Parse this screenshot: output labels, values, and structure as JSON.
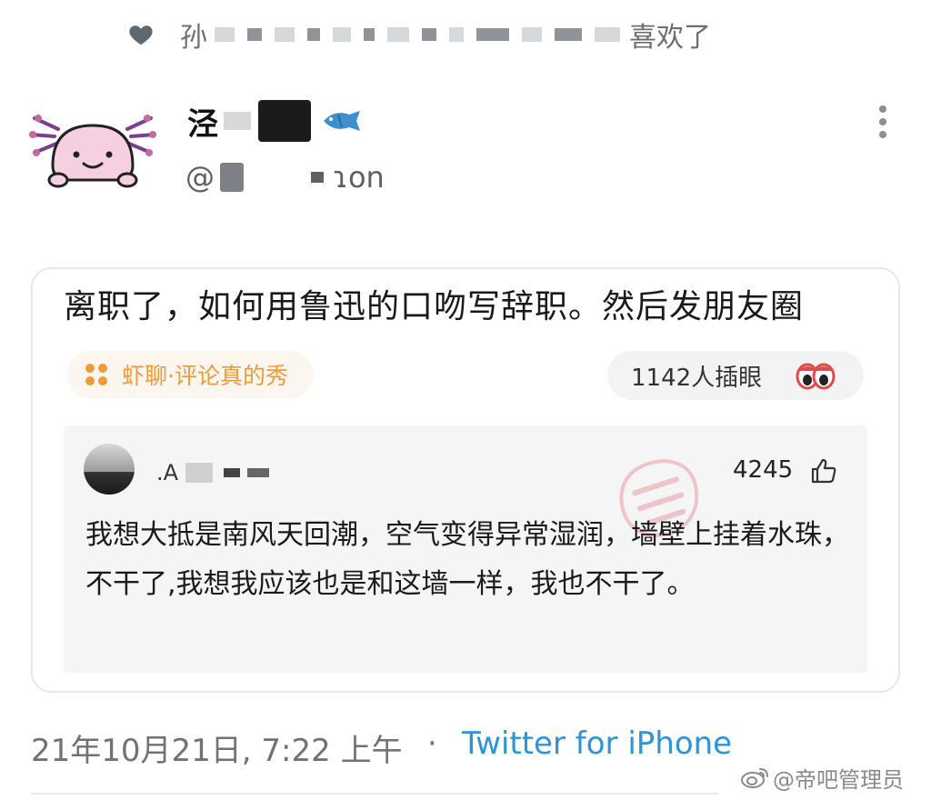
{
  "activity": {
    "liked_prefix": "孙",
    "liked_suffix": "喜欢了"
  },
  "tweet": {
    "author_name_initial": "泾",
    "author_handle_suffix": "ɿon",
    "quote_card": {
      "title": "离职了，如何用鲁迅的口吻写辞职。然后发朋友圈",
      "topic": "虾聊·评论真的秀",
      "views": "1142人插眼",
      "comment": {
        "username": "A",
        "likes": "4245",
        "text": "我想大抵是南风天回潮，空气变得异常湿润，墙壁上挂着水珠，不干了,我想我应该也是和这墙一样，我也不干了。"
      }
    },
    "timestamp": "21年10月21日, 7:22 上午",
    "separator": "·",
    "client": "Twitter for iPhone"
  },
  "watermark": {
    "text": "@帝吧管理员"
  },
  "icons": {
    "heart": "heart-icon",
    "fish": "fish-emoji-icon",
    "more": "more-vertical-icon",
    "topic": "grid-dots-icon",
    "eyes": "eyes-icon",
    "thumb": "thumbs-up-icon",
    "weibo": "weibo-logo-icon"
  },
  "colors": {
    "link": "#2f93d6",
    "topic_orange": "#f09a3a",
    "secondary_text": "#6f7378",
    "avatar_pink": "#f4c6dc",
    "avatar_purple": "#7a3f8e"
  }
}
